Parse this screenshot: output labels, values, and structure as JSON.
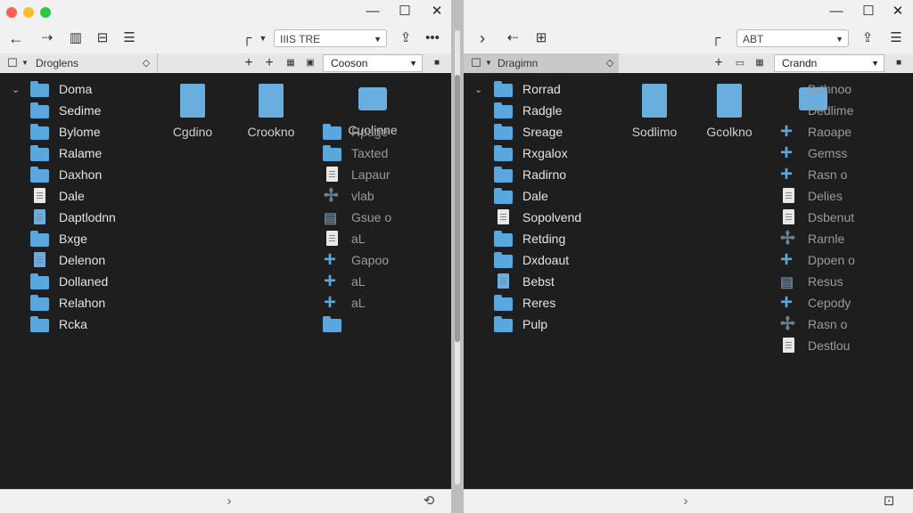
{
  "left": {
    "toolbar": {
      "view_combo": "IIIS TRE"
    },
    "pathbar": {
      "location": "Droglens",
      "search": "Cooson"
    },
    "sidebar": [
      "Doma",
      "Sedime",
      "Bylome",
      "Ralame",
      "Daxhon",
      "Dale",
      "Daptlodnn",
      "Bxge",
      "Delenon",
      "Dollaned",
      "Relahon",
      "Rcka"
    ],
    "big_items": [
      {
        "label": "Cgdino",
        "kind": "doc"
      },
      {
        "label": "Crookno",
        "kind": "doc"
      },
      {
        "label": "Cuolinne",
        "kind": "folder"
      }
    ],
    "list": [
      {
        "label": "Rpage",
        "icon": "folder"
      },
      {
        "label": "Taxted",
        "icon": "folder"
      },
      {
        "label": "Lapaur",
        "icon": "doc"
      },
      {
        "label": "vlab",
        "icon": "tool"
      },
      {
        "label": "Gsue o",
        "icon": "tray"
      },
      {
        "label": "aL",
        "icon": "doc"
      },
      {
        "label": "Gapoo",
        "icon": "plus"
      },
      {
        "label": "aL",
        "icon": "plus"
      },
      {
        "label": "aL",
        "icon": "plus"
      },
      {
        "label": "",
        "icon": "folder"
      }
    ]
  },
  "right": {
    "toolbar": {
      "view_combo": "ABT"
    },
    "pathbar": {
      "location": "Dragimn",
      "search": "Crandn"
    },
    "sidebar": [
      "Rorrad",
      "Radgle",
      "Sreage",
      "Rxgalox",
      "Radirno",
      "Dale",
      "Sopolvend",
      "Retding",
      "Dxdoaut",
      "Bebst",
      "Reres",
      "Pulp"
    ],
    "big_items": [
      {
        "label": "Sodlimo",
        "kind": "doc"
      },
      {
        "label": "Gcolkno",
        "kind": "doc"
      },
      {
        "label": "",
        "kind": "folder"
      }
    ],
    "list": [
      {
        "label": "Brthnoo",
        "icon": "none"
      },
      {
        "label": "Dedlime",
        "icon": "none"
      },
      {
        "label": "Raoape",
        "icon": "plus"
      },
      {
        "label": "Gemss",
        "icon": "plus"
      },
      {
        "label": "Rasn o",
        "icon": "plus"
      },
      {
        "label": "Delies",
        "icon": "doc"
      },
      {
        "label": "Dsbenut",
        "icon": "doc"
      },
      {
        "label": "Rarnle",
        "icon": "tool"
      },
      {
        "label": "Dpoen o",
        "icon": "plus"
      },
      {
        "label": "Resus",
        "icon": "tray"
      },
      {
        "label": "Cepody",
        "icon": "plus"
      },
      {
        "label": "Rasn o",
        "icon": "tool"
      },
      {
        "label": "Destlou",
        "icon": "doc"
      }
    ]
  },
  "colors": {
    "accent": "#5aa7dd",
    "window_bg": "#1e1e1e",
    "chrome": "#f1f1f1"
  }
}
